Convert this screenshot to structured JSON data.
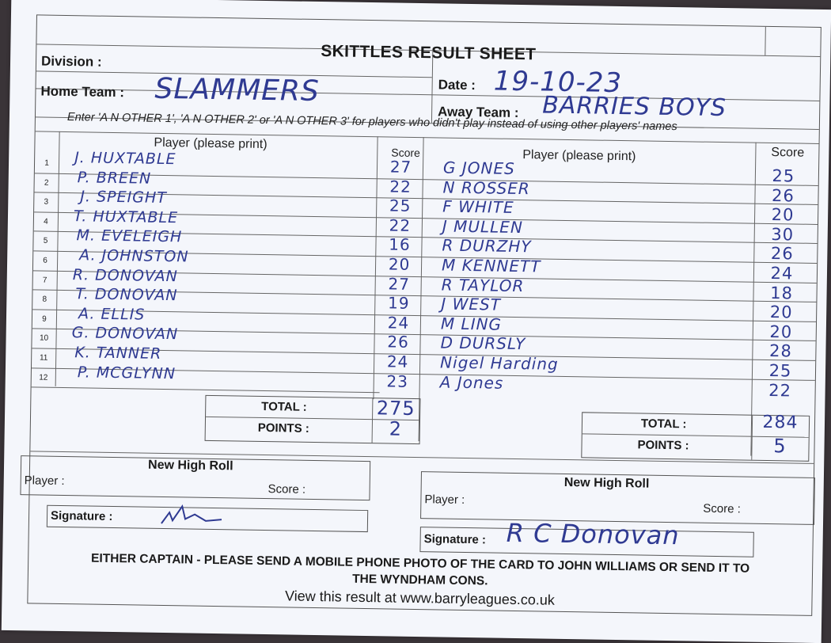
{
  "sheet": {
    "title": "SKITTLES RESULT SHEET",
    "division_label": "Division :",
    "date_label": "Date :",
    "date_value": "19-10-23",
    "home_team_label": "Home Team :",
    "home_team_value": "SLAMMERS",
    "away_team_label": "Away Team :",
    "away_team_value": "BARRIES BOYS",
    "instruction": "Enter 'A N OTHER 1', 'A N OTHER 2' or 'A N OTHER 3' for players who didn't play instead of using other players' names"
  },
  "home": {
    "player_header": "Player (please print)",
    "score_header": "Score",
    "rows": [
      {
        "num": "1",
        "player": "J. HUXTABLE",
        "score": "27"
      },
      {
        "num": "2",
        "player": "P. BREEN",
        "score": "22"
      },
      {
        "num": "3",
        "player": "J. SPEIGHT",
        "score": "25"
      },
      {
        "num": "4",
        "player": "T. HUXTABLE",
        "score": "22"
      },
      {
        "num": "5",
        "player": "M. EVELEIGH",
        "score": "16"
      },
      {
        "num": "6",
        "player": "A. JOHNSTON",
        "score": "20"
      },
      {
        "num": "7",
        "player": "R. DONOVAN",
        "score": "27"
      },
      {
        "num": "8",
        "player": "T. DONOVAN",
        "score": "19"
      },
      {
        "num": "9",
        "player": "A. ELLIS",
        "score": "24"
      },
      {
        "num": "10",
        "player": "G. DONOVAN",
        "score": "26"
      },
      {
        "num": "11",
        "player": "K. TANNER",
        "score": "24"
      },
      {
        "num": "12",
        "player": "P. MCGLYNN",
        "score": "23"
      }
    ],
    "total_label": "TOTAL :",
    "total_value": "275",
    "points_label": "POINTS :",
    "points_value": "2"
  },
  "away": {
    "player_header": "Player (please print)",
    "score_header": "Score",
    "rows": [
      {
        "player": "G JONES",
        "score": "25"
      },
      {
        "player": "N ROSSER",
        "score": "26"
      },
      {
        "player": "F WHITE",
        "score": "20"
      },
      {
        "player": "J MULLEN",
        "score": "30"
      },
      {
        "player": "R DURZHY",
        "score": "26"
      },
      {
        "player": "M KENNETT",
        "score": "24"
      },
      {
        "player": "R TAYLOR",
        "score": "18"
      },
      {
        "player": "J WEST",
        "score": "20"
      },
      {
        "player": "M LING",
        "score": "20"
      },
      {
        "player": "D DURSLY",
        "score": "28"
      },
      {
        "player": "Nigel Harding",
        "score": "25"
      },
      {
        "player": "A Jones",
        "score": "22"
      }
    ],
    "total_label": "TOTAL :",
    "total_value": "284",
    "points_label": "POINTS :",
    "points_value": "5"
  },
  "high_roll": {
    "home_heading": "New High Roll",
    "home_player_label": "Player :",
    "home_score_label": "Score :",
    "home_signature_label": "Signature :",
    "away_heading": "New High Roll",
    "away_player_label": "Player :",
    "away_score_label": "Score :",
    "away_signature_label": "Signature :",
    "away_signature_value": "R C Donovan"
  },
  "footer": {
    "line1": "EITHER CAPTAIN - PLEASE SEND A MOBILE PHONE PHOTO OF THE CARD TO JOHN WILLIAMS OR SEND IT TO",
    "line2": "THE WYNDHAM CONS.",
    "line3": "View this result at www.barryleagues.co.uk"
  },
  "colors": {
    "ink": "#2f3a92",
    "paper": "#f4f6fb"
  }
}
